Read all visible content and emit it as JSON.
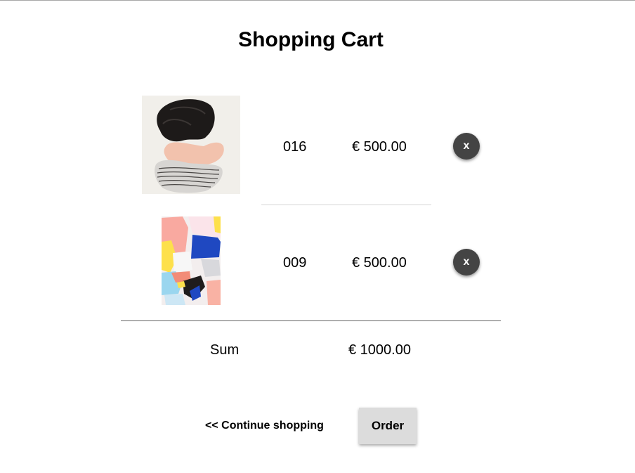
{
  "page": {
    "title": "Shopping Cart"
  },
  "cart": {
    "items": [
      {
        "code": "016",
        "price": "€ 500.00",
        "remove_label": "x",
        "artwork": "abstract-portrait-painting"
      },
      {
        "code": "009",
        "price": "€ 500.00",
        "remove_label": "x",
        "artwork": "colorful-abstract-shapes-painting"
      }
    ],
    "sum_label": "Sum",
    "sum_value": "€ 1000.00"
  },
  "actions": {
    "continue_label": "<< Continue shopping",
    "order_label": "Order"
  },
  "colors": {
    "remove_button": "#444444",
    "order_button": "#dcdcdc"
  }
}
